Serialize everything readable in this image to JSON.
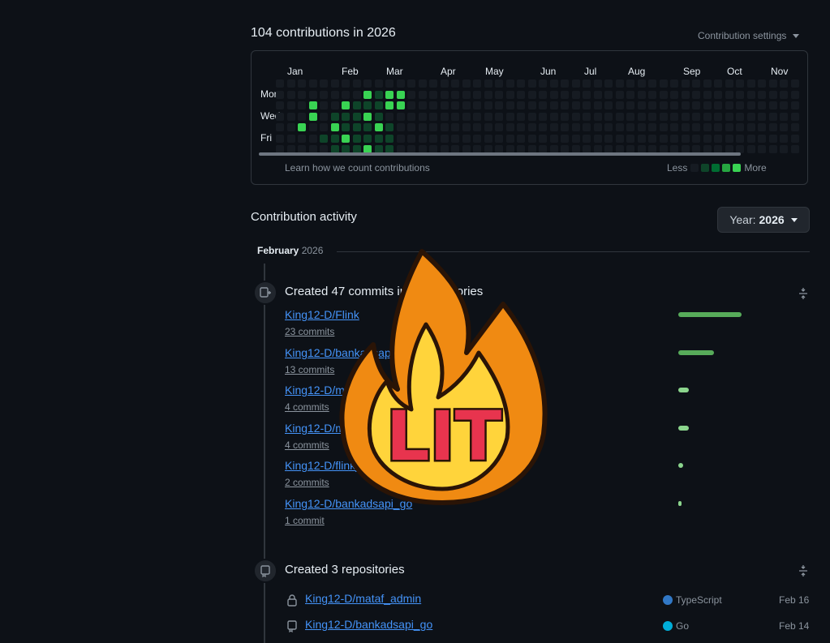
{
  "header": {
    "title": "104 contributions in 2026",
    "settings_label": "Contribution settings"
  },
  "graph": {
    "months": [
      "Jan",
      "Feb",
      "Mar",
      "Apr",
      "May",
      "Jun",
      "Jul",
      "Aug",
      "Sep",
      "Oct",
      "Nov"
    ],
    "day_labels": [
      "Mon",
      "Wed",
      "Fri"
    ],
    "learn_link": "Learn how we count contributions",
    "legend_less": "Less",
    "legend_more": "More",
    "legend_colors": [
      "#161b22",
      "#0e4429",
      "#006d32",
      "#26a641",
      "#39d353"
    ],
    "levels": [
      [
        0,
        0,
        0,
        0,
        0,
        0,
        0
      ],
      [
        0,
        0,
        0,
        0,
        0,
        0,
        0
      ],
      [
        0,
        0,
        0,
        0,
        4,
        0,
        0
      ],
      [
        0,
        0,
        4,
        4,
        0,
        0,
        0
      ],
      [
        0,
        0,
        0,
        0,
        0,
        1,
        0
      ],
      [
        0,
        0,
        0,
        1,
        4,
        1,
        1
      ],
      [
        0,
        0,
        4,
        1,
        1,
        4,
        1
      ],
      [
        0,
        0,
        1,
        1,
        1,
        1,
        1
      ],
      [
        0,
        4,
        1,
        4,
        1,
        1,
        4
      ],
      [
        0,
        1,
        1,
        1,
        4,
        1,
        1
      ],
      [
        0,
        4,
        4,
        0,
        1,
        1,
        1
      ],
      [
        0,
        4,
        4,
        0,
        0,
        0,
        0
      ]
    ]
  },
  "activity": {
    "heading": "Contribution activity",
    "year_prefix": "Year:",
    "year_value": "2026",
    "month_label": "February",
    "month_year": "2026",
    "commits_block": {
      "title": "Created 47 commits in 6 repositories",
      "repos": [
        {
          "name": "King12-D/Flink",
          "count": "23 commits",
          "ratio": 1.0
        },
        {
          "name": "King12-D/bankadsapi",
          "count": "13 commits",
          "ratio": 0.57
        },
        {
          "name": "King12-D/mataf_admin",
          "count": "4 commits",
          "ratio": 0.17
        },
        {
          "name": "King12-D/mataf",
          "count": "4 commits",
          "ratio": 0.17
        },
        {
          "name": "King12-D/flink_bot",
          "count": "2 commits",
          "ratio": 0.08
        },
        {
          "name": "King12-D/bankadsapi_go",
          "count": "1 commit",
          "ratio": 0.04
        }
      ]
    },
    "repos_block": {
      "title": "Created 3 repositories",
      "repos": [
        {
          "name": "King12-D/mataf_admin",
          "icon": "lock-icon",
          "language": "TypeScript",
          "lang_color": "#3178c6",
          "date": "Feb 16"
        },
        {
          "name": "King12-D/bankadsapi_go",
          "icon": "repo-icon",
          "language": "Go",
          "lang_color": "#00add8",
          "date": "Feb 14"
        }
      ]
    }
  },
  "sticker": {
    "text": "LIT"
  }
}
